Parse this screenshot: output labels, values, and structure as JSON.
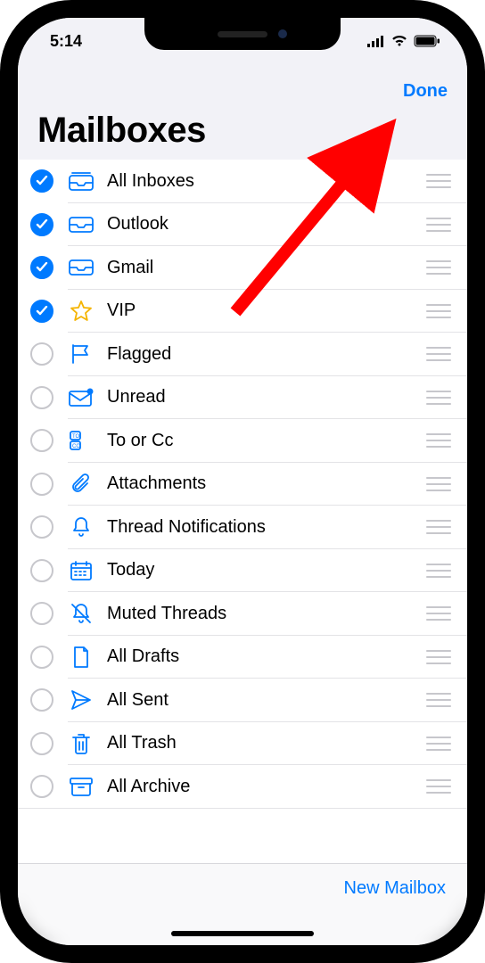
{
  "statusbar": {
    "time": "5:14"
  },
  "nav": {
    "done": "Done",
    "title": "Mailboxes"
  },
  "toolbar": {
    "new_mailbox": "New Mailbox"
  },
  "rows": [
    {
      "label": "All Inboxes",
      "checked": true,
      "icon": "all-inboxes"
    },
    {
      "label": "Outlook",
      "checked": true,
      "icon": "inbox"
    },
    {
      "label": "Gmail",
      "checked": true,
      "icon": "inbox"
    },
    {
      "label": "VIP",
      "checked": true,
      "icon": "star"
    },
    {
      "label": "Flagged",
      "checked": false,
      "icon": "flag"
    },
    {
      "label": "Unread",
      "checked": false,
      "icon": "unread"
    },
    {
      "label": "To or Cc",
      "checked": false,
      "icon": "to-cc"
    },
    {
      "label": "Attachments",
      "checked": false,
      "icon": "attachment"
    },
    {
      "label": "Thread Notifications",
      "checked": false,
      "icon": "bell"
    },
    {
      "label": "Today",
      "checked": false,
      "icon": "calendar"
    },
    {
      "label": "Muted Threads",
      "checked": false,
      "icon": "bell-slash"
    },
    {
      "label": "All Drafts",
      "checked": false,
      "icon": "draft"
    },
    {
      "label": "All Sent",
      "checked": false,
      "icon": "sent"
    },
    {
      "label": "All Trash",
      "checked": false,
      "icon": "trash"
    },
    {
      "label": "All Archive",
      "checked": false,
      "icon": "archive"
    }
  ],
  "annotation": {
    "points_to": "done-button",
    "color": "#ff0000"
  }
}
